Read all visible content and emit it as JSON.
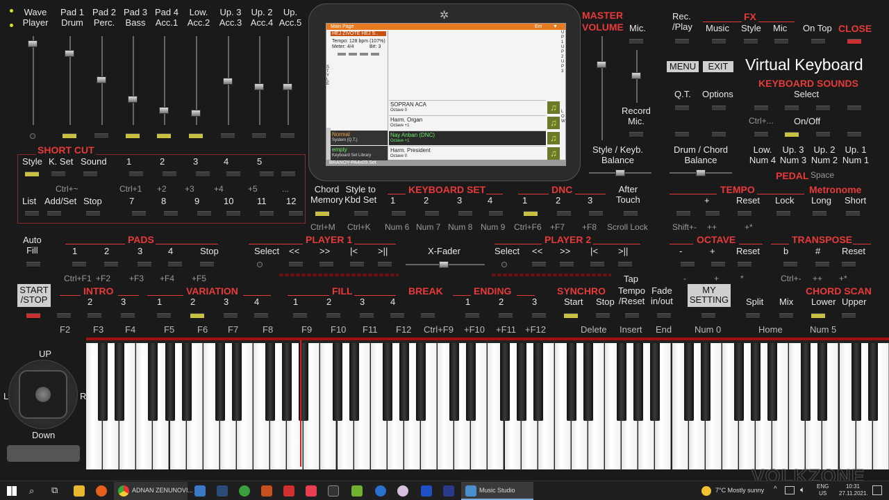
{
  "mixer": {
    "channels": [
      "Wave\nPlayer",
      "Pad 1\nDrum",
      "Pad 2\nPerc.",
      "Pad 3\nBass",
      "Pad 4\nAcc.1",
      "Low.\nAcc.2",
      "Up. 3\nAcc.3",
      "Up. 2\nAcc.4",
      "Up.\nAcc.5"
    ],
    "master": "MASTER",
    "volume": "VOLUME",
    "mic": "Mic.",
    "record_mic": "Record\nMic.",
    "style_keyb_balance": "Style / Keyb.\nBalance",
    "drum_chord_balance": "Drum / Chord\nBalance"
  },
  "top_right": {
    "rec_play": "Rec.\n/Play",
    "fx": "FX",
    "fx_items": [
      "Music",
      "Style",
      "Mic"
    ],
    "on_top": "On Top",
    "close": "CLOSE",
    "menu": "MENU",
    "exit": "EXIT",
    "app_title": "Virtual Keyboard",
    "qt": "Q.T.",
    "options": "Options",
    "keyboard_sounds": "KEYBOARD SOUNDS",
    "select": "Select",
    "ctrl_plus": "Ctrl+...",
    "on_off": "On/Off",
    "sound_labels": [
      "Low.\nNum 4",
      "Up. 3\nNum 3",
      "Up. 2\nNum 2",
      "Up. 1\nNum 1"
    ],
    "pedal": "PEDAL",
    "space": "Space"
  },
  "shortcut": {
    "title": "SHORT CUT",
    "row1": [
      "Style",
      "K. Set",
      "Sound",
      "1",
      "2",
      "3",
      "4",
      "5"
    ],
    "row1_sub": [
      "Ctrl+~",
      "Ctrl+1",
      "+2",
      "+3",
      "+4",
      "+5",
      "..."
    ],
    "row2": [
      "List",
      "Add/Set",
      "Stop",
      "7",
      "8",
      "9",
      "10",
      "11",
      "12"
    ]
  },
  "display": {
    "header": "Main Page",
    "header_right": "Em",
    "song": "HEJ ZIVOTE HEJ S..",
    "tempo": "Tempo: 128 bpm (107%)",
    "meter": "Meter: 4/4",
    "bar": "B#:  3",
    "rows": [
      {
        "name": "SOPRAN ACA",
        "octave": "Octave 0"
      },
      {
        "name": "Harm. Organ",
        "octave": "Octave +1"
      },
      {
        "name": "Nay Anban (DNC)",
        "octave": "Octave +1"
      },
      {
        "name": "Harm. President",
        "octave": "Octave 0"
      }
    ],
    "left_rows": [
      {
        "name": "Normal",
        "sub": "System (Q.T.)"
      },
      {
        "name": "empty",
        "sub": "Keyboard Set Library"
      }
    ],
    "footer": "BRANOY-PA4x09.Set",
    "side_up": "UP1UP2UP3",
    "side_low": "LOW",
    "side_style": "STYLE"
  },
  "mid_row": {
    "chord_memory": "Chord\nMemory",
    "style_to_kbd": "Style to\nKbd Set",
    "keyboard_set": "KEYBOARD SET",
    "ks_nums": [
      "1",
      "2",
      "3",
      "4"
    ],
    "dnc": "DNC",
    "dnc_nums": [
      "1",
      "2",
      "3"
    ],
    "after_touch": "After\nTouch",
    "tempo": "TEMPO",
    "tempo_items": [
      "+",
      "Reset",
      "Lock"
    ],
    "metronome": "Metronome",
    "metro_items": [
      "Long",
      "Short"
    ],
    "subs": [
      "Ctrl+M",
      "Ctrl+K",
      "Num 6",
      "Num 7",
      "Num 8",
      "Num 9",
      "Ctrl+F6",
      "+F7",
      "+F8",
      "Scroll Lock",
      "Shift+-",
      "++",
      "+*"
    ]
  },
  "row3": {
    "auto_fill": "Auto\nFill",
    "pads": "PADS",
    "pads_items": [
      "1",
      "2",
      "3",
      "4",
      "Stop"
    ],
    "pads_subs": [
      "Ctrl+F1",
      "+F2",
      "+F3",
      "+F4",
      "+F5"
    ],
    "player1": "PLAYER 1",
    "player1_items": [
      "Select",
      "<<",
      ">>",
      "|<",
      ">||"
    ],
    "xfader": "X-Fader",
    "player2": "PLAYER 2",
    "player2_items": [
      "Select",
      "<<",
      ">>",
      "|<",
      ">||"
    ],
    "tap": "Tap",
    "octave": "OCTAVE",
    "octave_items": [
      "-",
      "+",
      "Reset"
    ],
    "octave_subs": [
      "-",
      "+",
      "*"
    ],
    "transpose": "TRANSPOSE",
    "transpose_items": [
      "b",
      "#",
      "Reset"
    ],
    "transpose_subs": [
      "Ctrl+-",
      "++",
      "+*"
    ]
  },
  "row4": {
    "start_stop": "START\n/STOP",
    "intro": "INTRO",
    "intro_items": [
      "2",
      "3"
    ],
    "variation": "VARIATION",
    "var_items": [
      "1",
      "2",
      "3",
      "4"
    ],
    "fill": "FILL",
    "fill_items": [
      "1",
      "2",
      "3",
      "4"
    ],
    "break": "BREAK",
    "ending": "ENDING",
    "ending_items": [
      "1",
      "2",
      "3"
    ],
    "synchro": "SYNCHRO",
    "synchro_items": [
      "Start",
      "Stop"
    ],
    "tempo_reset": "Tempo\n/Reset",
    "fade": "Fade\nin/out",
    "my_setting": "MY\nSETTING",
    "split": "Split",
    "mix": "Mix",
    "chord_scan": "CHORD SCAN",
    "chord_scan_items": [
      "Lower",
      "Upper"
    ],
    "subs": [
      "F2",
      "F3",
      "F4",
      "F5",
      "F6",
      "F7",
      "F8",
      "F9",
      "F10",
      "F11",
      "F12",
      "Ctrl+F9",
      "+F10",
      "+F11",
      "+F12",
      "Delete",
      "Insert",
      "End",
      "Num 0",
      "Home",
      "Num 5"
    ]
  },
  "joystick": {
    "up": "UP",
    "down": "Down",
    "left": "L",
    "right": "R"
  },
  "watermark": "VOLKZONE",
  "taskbar": {
    "chrome_tab": "ADNAN ZENUNOVI...",
    "music_studio": "Music Studio",
    "weather": "7°C  Mostly sunny",
    "lang": "ENG\nUS",
    "time": "10:31",
    "date": "27.11.2021."
  }
}
